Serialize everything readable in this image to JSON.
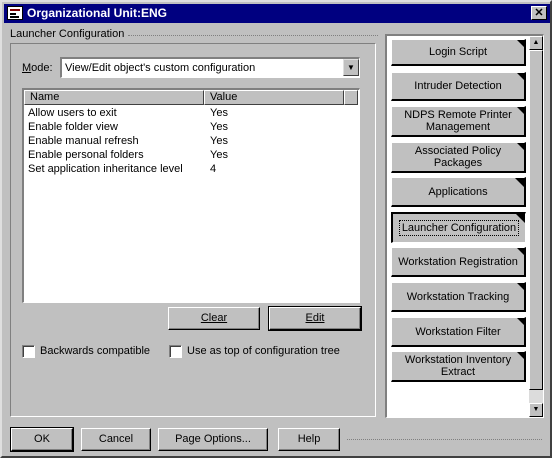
{
  "window": {
    "title": "Organizational Unit:ENG",
    "close_glyph": "✕"
  },
  "launcher": {
    "group_label": "Launcher Configuration",
    "mode_label_prefix": "M",
    "mode_label_rest": "ode:",
    "mode_value": "View/Edit object's custom configuration",
    "columns": [
      "Name",
      "Value"
    ],
    "rows": [
      {
        "name": "Allow users to exit",
        "value": "Yes"
      },
      {
        "name": "Enable folder view",
        "value": "Yes"
      },
      {
        "name": "Enable manual refresh",
        "value": "Yes"
      },
      {
        "name": "Enable personal folders",
        "value": "Yes"
      },
      {
        "name": "Set application inheritance level",
        "value": "4"
      }
    ],
    "clear_label": "Clear",
    "edit_label": "Edit",
    "backwards_compatible_label": "Backwards compatible",
    "backwards_compatible_checked": false,
    "top_of_tree_label": "Use as top of configuration tree",
    "top_of_tree_checked": false
  },
  "page_tabs": [
    {
      "label": "Login Script",
      "selected": false
    },
    {
      "label": "Intruder Detection",
      "selected": false
    },
    {
      "label": "NDPS Remote Printer Management",
      "selected": false
    },
    {
      "label": "Associated Policy Packages",
      "selected": false
    },
    {
      "label": "Applications",
      "selected": false
    },
    {
      "label": "Launcher Configuration",
      "selected": true
    },
    {
      "label": "Workstation Registration",
      "selected": false
    },
    {
      "label": "Workstation Tracking",
      "selected": false
    },
    {
      "label": "Workstation Filter",
      "selected": false
    },
    {
      "label": "Workstation Inventory Extract",
      "selected": false
    }
  ],
  "footer": {
    "ok_label": "OK",
    "cancel_label": "Cancel",
    "page_options_label": "Page Options...",
    "help_label": "Help"
  },
  "colors": {
    "title_bar": "#000080",
    "face": "#c0c0c0",
    "list_background": "#ffffff"
  },
  "icons": {
    "title": "window-properties-icon",
    "close": "close-icon",
    "dropdown": "chevron-down-icon",
    "scroll_up": "arrow-up-icon",
    "scroll_down": "arrow-down-icon",
    "tab_corner": "page-corner-icon"
  }
}
